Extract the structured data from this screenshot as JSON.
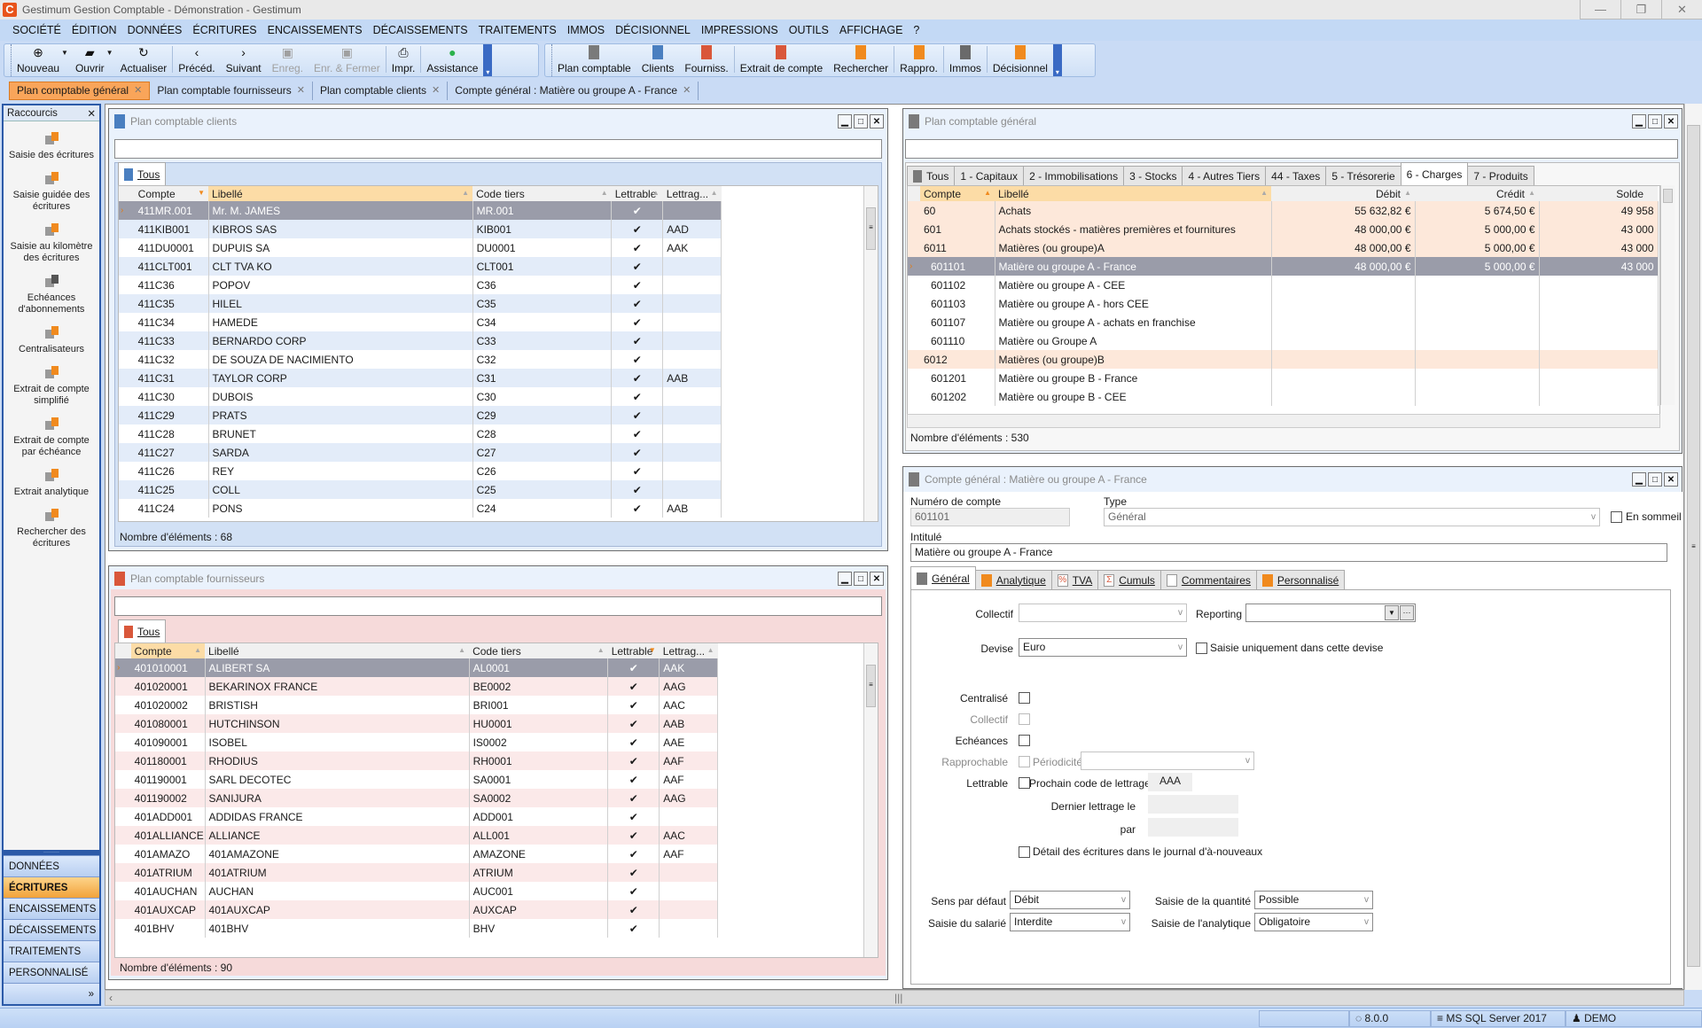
{
  "app": {
    "title": "Gestimum Gestion Comptable - Démonstration - Gestimum",
    "logo_letter": "C",
    "window_controls": {
      "minimize": "—",
      "restore": "❐",
      "close": "✕"
    }
  },
  "menu": [
    "SOCIÉTÉ",
    "ÉDITION",
    "DONNÉES",
    "ÉCRITURES",
    "ENCAISSEMENTS",
    "DÉCAISSEMENTS",
    "TRAITEMENTS",
    "IMMOS",
    "DÉCISIONNEL",
    "IMPRESSIONS",
    "OUTILS",
    "AFFICHAGE",
    "?"
  ],
  "toolbar": {
    "group1": [
      {
        "label": "Nouveau",
        "icon": "plus-circle-icon",
        "glyph": "⊕",
        "dropdown": true,
        "enabled": true
      },
      {
        "label": "Ouvrir",
        "icon": "folder-icon",
        "glyph": "▰",
        "dropdown": true,
        "enabled": true
      },
      {
        "label": "Actualiser",
        "icon": "refresh-icon",
        "glyph": "↻",
        "enabled": true
      },
      {
        "label": "Précéd.",
        "icon": "chevron-left-icon",
        "glyph": "‹",
        "enabled": true
      },
      {
        "label": "Suivant",
        "icon": "chevron-right-icon",
        "glyph": "›",
        "enabled": true
      },
      {
        "label": "Enreg.",
        "icon": "save-icon",
        "glyph": "▣",
        "enabled": false
      },
      {
        "label": "Enr. & Fermer",
        "icon": "save-close-icon",
        "glyph": "▣",
        "enabled": false
      },
      {
        "label": "Impr.",
        "icon": "printer-icon",
        "glyph": "⎙",
        "enabled": true
      },
      {
        "label": "Assistance",
        "icon": "whatsapp-icon",
        "glyph": "●",
        "enabled": true
      }
    ],
    "group2": [
      {
        "label": "Plan comptable",
        "icon": "ledger-gray-icon",
        "color": "#7a7a7a"
      },
      {
        "label": "Clients",
        "icon": "ledger-blue-icon",
        "color": "#4a7fc0"
      },
      {
        "label": "Fourniss.",
        "icon": "ledger-red-icon",
        "color": "#d9573a"
      },
      {
        "label": "Extrait de compte",
        "icon": "calendar-icon",
        "color": "#d9573a"
      },
      {
        "label": "Rechercher",
        "icon": "search-icon",
        "color": "#f08a1e"
      },
      {
        "label": "Rappro.",
        "icon": "reconcile-icon",
        "color": "#f08a1e"
      },
      {
        "label": "Immos",
        "icon": "house-icon",
        "color": "#6a6a6a"
      },
      {
        "label": "Décisionnel",
        "icon": "pie-chart-icon",
        "color": "#f08a1e"
      }
    ]
  },
  "doc_tabs": [
    {
      "label": "Plan comptable général",
      "active": true
    },
    {
      "label": "Plan comptable fournisseurs",
      "active": false
    },
    {
      "label": "Plan comptable clients",
      "active": false
    },
    {
      "label": "Compte général : Matière ou groupe A - France",
      "active": false
    }
  ],
  "sidebar": {
    "title": "Raccourcis",
    "shortcuts": [
      {
        "label": "Saisie des écritures",
        "icon": "pen-entry-icon"
      },
      {
        "label": "Saisie guidée des écritures",
        "icon": "guided-entry-icon"
      },
      {
        "label": "Saisie au kilomètre des écritures",
        "icon": "bulk-entry-icon"
      },
      {
        "label": "Echéances d'abonnements",
        "icon": "recurring-icon"
      },
      {
        "label": "Centralisateurs",
        "icon": "sigma-table-icon"
      },
      {
        "label": "Extrait de compte simplifié",
        "icon": "simple-extract-icon"
      },
      {
        "label": "Extrait de compte par échéance",
        "icon": "due-extract-icon"
      },
      {
        "label": "Extrait analytique",
        "icon": "analytic-extract-icon"
      },
      {
        "label": "Rechercher des écritures",
        "icon": "search-entries-icon"
      }
    ],
    "nav": [
      {
        "label": "DONNÉES",
        "active": false
      },
      {
        "label": "ÉCRITURES",
        "active": true
      },
      {
        "label": "ENCAISSEMENTS",
        "active": false
      },
      {
        "label": "DÉCAISSEMENTS",
        "active": false
      },
      {
        "label": "TRAITEMENTS",
        "active": false
      },
      {
        "label": "PERSONNALISÉ",
        "active": false
      }
    ],
    "more_glyph": "»"
  },
  "clients": {
    "title": "Plan comptable clients",
    "search_value": "",
    "tab": "Tous",
    "columns": [
      "Compte",
      "Libellé",
      "Code tiers",
      "Lettrable",
      "Lettrag..."
    ],
    "rows": [
      [
        "411MR.001",
        "Mr. M. JAMES",
        "MR.001",
        "✔",
        ""
      ],
      [
        "411KIB001",
        "KIBROS SAS",
        "KIB001",
        "✔",
        "AAD"
      ],
      [
        "411DU0001",
        "DUPUIS SA",
        "DU0001",
        "✔",
        "AAK"
      ],
      [
        "411CLT001",
        "CLT TVA KO",
        "CLT001",
        "✔",
        ""
      ],
      [
        "411C36",
        "POPOV",
        "C36",
        "✔",
        ""
      ],
      [
        "411C35",
        "HILEL",
        "C35",
        "✔",
        ""
      ],
      [
        "411C34",
        "HAMEDE",
        "C34",
        "✔",
        ""
      ],
      [
        "411C33",
        "BERNARDO CORP",
        "C33",
        "✔",
        ""
      ],
      [
        "411C32",
        "DE SOUZA DE NACIMIENTO",
        "C32",
        "✔",
        ""
      ],
      [
        "411C31",
        "TAYLOR CORP",
        "C31",
        "✔",
        "AAB"
      ],
      [
        "411C30",
        "DUBOIS",
        "C30",
        "✔",
        ""
      ],
      [
        "411C29",
        "PRATS",
        "C29",
        "✔",
        ""
      ],
      [
        "411C28",
        "BRUNET",
        "C28",
        "✔",
        ""
      ],
      [
        "411C27",
        "SARDA",
        "C27",
        "✔",
        ""
      ],
      [
        "411C26",
        "REY",
        "C26",
        "✔",
        ""
      ],
      [
        "411C25",
        "COLL",
        "C25",
        "✔",
        ""
      ],
      [
        "411C24",
        "PONS",
        "C24",
        "✔",
        "AAB"
      ]
    ],
    "selected_row": 0,
    "count_text": "Nombre d'éléments : 68"
  },
  "suppliers": {
    "title": "Plan comptable fournisseurs",
    "search_value": "",
    "tab": "Tous",
    "columns": [
      "Compte",
      "Libellé",
      "Code tiers",
      "Lettrable",
      "Lettrag..."
    ],
    "rows": [
      [
        "401010001",
        "ALIBERT SA",
        "AL0001",
        "✔",
        "AAK"
      ],
      [
        "401020001",
        "BEKARINOX FRANCE",
        "BE0002",
        "✔",
        "AAG"
      ],
      [
        "401020002",
        "BRISTISH",
        "BRI001",
        "✔",
        "AAC"
      ],
      [
        "401080001",
        "HUTCHINSON",
        "HU0001",
        "✔",
        "AAB"
      ],
      [
        "401090001",
        "ISOBEL",
        "IS0002",
        "✔",
        "AAE"
      ],
      [
        "401180001",
        "RHODIUS",
        "RH0001",
        "✔",
        "AAF"
      ],
      [
        "401190001",
        "SARL DECOTEC",
        "SA0001",
        "✔",
        "AAF"
      ],
      [
        "401190002",
        "SANIJURA",
        "SA0002",
        "✔",
        "AAG"
      ],
      [
        "401ADD001",
        "ADDIDAS FRANCE",
        "ADD001",
        "✔",
        ""
      ],
      [
        "401ALLIANCE",
        "ALLIANCE",
        "ALL001",
        "✔",
        "AAC"
      ],
      [
        "401AMAZO",
        "401AMAZONE",
        "AMAZONE",
        "✔",
        "AAF"
      ],
      [
        "401ATRIUM",
        "401ATRIUM",
        "ATRIUM",
        "✔",
        ""
      ],
      [
        "401AUCHAN",
        "AUCHAN",
        "AUC001",
        "✔",
        ""
      ],
      [
        "401AUXCAP",
        "401AUXCAP",
        "AUXCAP",
        "✔",
        ""
      ],
      [
        "401BHV",
        "401BHV",
        "BHV",
        "✔",
        ""
      ]
    ],
    "selected_row": 0,
    "count_text": "Nombre d'éléments : 90"
  },
  "general": {
    "title": "Plan comptable général",
    "search_value": "",
    "tabs": [
      {
        "label": "Tous",
        "active": false
      },
      {
        "label": "1 - Capitaux",
        "active": false
      },
      {
        "label": "2 - Immobilisations",
        "active": false
      },
      {
        "label": "3 - Stocks",
        "active": false
      },
      {
        "label": "4 - Autres Tiers",
        "active": false
      },
      {
        "label": "44 - Taxes",
        "active": false
      },
      {
        "label": "5 - Trésorerie",
        "active": false
      },
      {
        "label": "6 - Charges",
        "active": true
      },
      {
        "label": "7 - Produits",
        "active": false
      }
    ],
    "columns": [
      "Compte",
      "Libellé",
      "Débit",
      "Crédit",
      "Solde"
    ],
    "rows": [
      {
        "cells": [
          "60",
          "Achats",
          "55 632,82 €",
          "5 674,50 €",
          "49 958"
        ],
        "group": true
      },
      {
        "cells": [
          "601",
          "Achats stockés - matières premières et fournitures",
          "48 000,00 €",
          "5 000,00 €",
          "43 000"
        ],
        "group": true
      },
      {
        "cells": [
          "6011",
          "Matières (ou groupe)A",
          "48 000,00 €",
          "5 000,00 €",
          "43 000"
        ],
        "group": true
      },
      {
        "cells": [
          "601101",
          "Matière ou groupe A - France",
          "48 000,00 €",
          "5 000,00 €",
          "43 000"
        ],
        "group": false,
        "selected": true
      },
      {
        "cells": [
          "601102",
          "Matière ou groupe A - CEE",
          "",
          "",
          ""
        ],
        "group": false
      },
      {
        "cells": [
          "601103",
          "Matière ou groupe A - hors CEE",
          "",
          "",
          ""
        ],
        "group": false
      },
      {
        "cells": [
          "601107",
          "Matière ou groupe A - achats en franchise",
          "",
          "",
          ""
        ],
        "group": false
      },
      {
        "cells": [
          "601110",
          "Matière ou Groupe A",
          "",
          "",
          ""
        ],
        "group": false
      },
      {
        "cells": [
          "6012",
          "Matières (ou groupe)B",
          "",
          "",
          ""
        ],
        "group": true
      },
      {
        "cells": [
          "601201",
          "Matière ou groupe B - France",
          "",
          "",
          ""
        ],
        "group": false
      },
      {
        "cells": [
          "601202",
          "Matière ou groupe B - CEE",
          "",
          "",
          ""
        ],
        "group": false
      }
    ],
    "count_text": "Nombre d'éléments : 530"
  },
  "account": {
    "title": "Compte général : Matière ou groupe A - France",
    "numero_label": "Numéro de compte",
    "numero_value": "601101",
    "type_label": "Type",
    "type_value": "Général",
    "sommeil_label": "En sommeil",
    "sommeil_checked": false,
    "intitule_label": "Intitulé",
    "intitule_value": "Matière ou groupe A - France",
    "tabs": [
      {
        "label": "Général",
        "icon": "ledger-gray-icon",
        "active": true
      },
      {
        "label": "Analytique",
        "icon": "bar-chart-icon",
        "active": false
      },
      {
        "label": "TVA",
        "icon": "percent-icon",
        "active": false
      },
      {
        "label": "Cumuls",
        "icon": "sigma-icon",
        "active": false
      },
      {
        "label": "Commentaires",
        "icon": "note-icon",
        "active": false
      },
      {
        "label": "Personnalisé",
        "icon": "custom-fields-icon",
        "active": false
      }
    ],
    "collectif_label": "Collectif",
    "collectif_value": "",
    "reporting_label": "Reporting",
    "reporting_value": "",
    "devise_label": "Devise",
    "devise_value": "Euro",
    "saisie_devise_label": "Saisie uniquement dans cette devise",
    "centralise_label": "Centralisé",
    "collectif2_label": "Collectif",
    "echeances_label": "Echéances",
    "rapprochable_label": "Rapprochable",
    "periodicite_label": "Périodicité",
    "periodicite_value": "",
    "lettrable_label": "Lettrable",
    "prochain_label": "Prochain code de lettrage",
    "prochain_value": "AAA",
    "dernier_label": "Dernier lettrage le",
    "dernier_value": "",
    "par_label": "par",
    "par_value": "",
    "detail_label": "Détail des écritures dans le journal d'à-nouveaux",
    "sens_label": "Sens par défaut",
    "sens_value": "Débit",
    "quantite_label": "Saisie de la quantité",
    "quantite_value": "Possible",
    "salarie_label": "Saisie du salarié",
    "salarie_value": "Interdite",
    "analytique_label": "Saisie de l'analytique",
    "analytique_value": "Obligatoire"
  },
  "status": {
    "version": "8.0.0",
    "database": "MS SQL Server 2017",
    "user": "DEMO"
  },
  "colors": {
    "clients_accent": "#4a7fc0",
    "suppliers_accent": "#d9573a",
    "general_accent": "#7a7a7a",
    "active_tab": "#f9a55a",
    "selected_row": "#9a9ca9",
    "group_row": "#fde8da"
  }
}
